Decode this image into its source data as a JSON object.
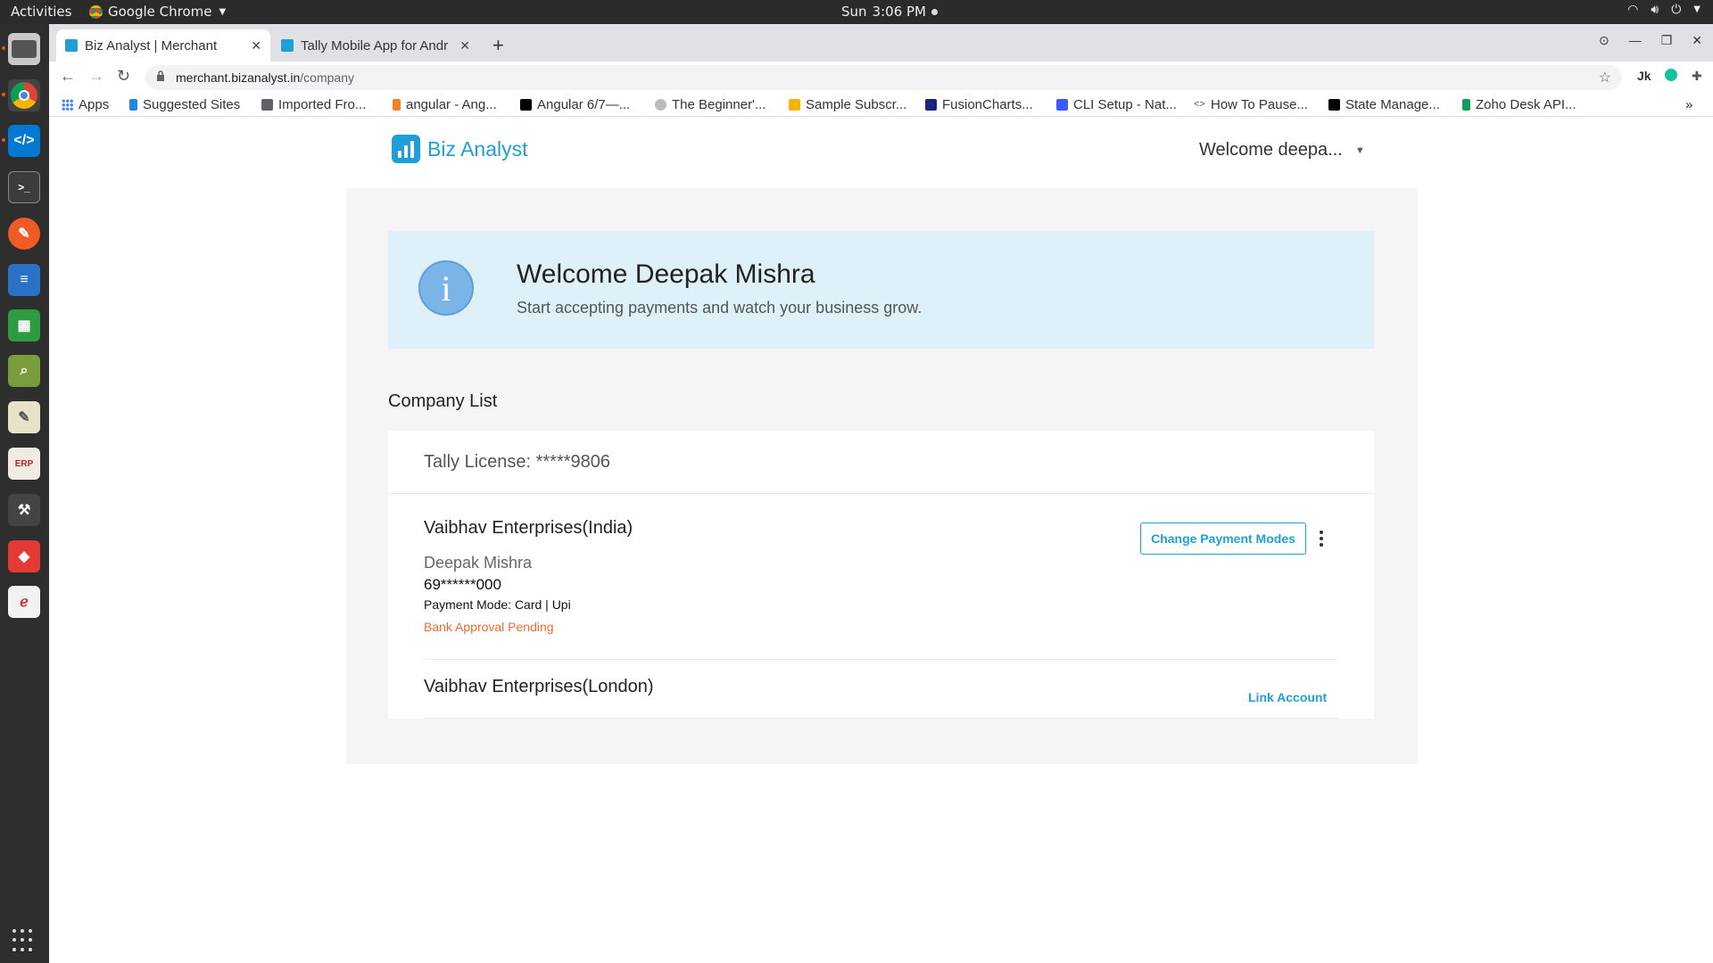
{
  "os": {
    "activities": "Activities",
    "app_name": "Google Chrome",
    "clock_day": "Sun",
    "clock_time": "3:06 PM"
  },
  "browser": {
    "tabs": [
      {
        "title": "Biz Analyst | Merchant",
        "active": true
      },
      {
        "title": "Tally Mobile App for Andr",
        "active": false
      }
    ],
    "url_host": "merchant.bizanalyst.in",
    "url_path": "/company",
    "bookmarks": [
      {
        "label": "Apps",
        "icon": "apps-grid-icon"
      },
      {
        "label": "Suggested Sites",
        "icon": "bing-icon"
      },
      {
        "label": "Imported Fro...",
        "icon": "folder-icon"
      },
      {
        "label": "angular - Ang...",
        "icon": "stackoverflow-icon"
      },
      {
        "label": "Angular 6/7—...",
        "icon": "medium-icon"
      },
      {
        "label": "The Beginner'...",
        "icon": "globe-icon"
      },
      {
        "label": "Sample Subscr...",
        "icon": "slides-icon"
      },
      {
        "label": "FusionCharts...",
        "icon": "fusioncharts-icon"
      },
      {
        "label": "CLI Setup - Nat...",
        "icon": "nativescript-icon"
      },
      {
        "label": "How To Pause...",
        "icon": "code-icon"
      },
      {
        "label": "State Manage...",
        "icon": "medium-icon"
      },
      {
        "label": "Zoho Desk API...",
        "icon": "zoho-icon"
      }
    ],
    "bookmarks_overflow": "»"
  },
  "app": {
    "brand": "Biz Analyst",
    "user_menu": "Welcome deepa...",
    "banner": {
      "title": "Welcome Deepak Mishra",
      "subtitle": "Start accepting payments and watch your business grow.",
      "icon": "i"
    },
    "company_heading": "Company List",
    "license": "Tally License: *****9806",
    "companies": [
      {
        "name": "Vaibhav Enterprises(India)",
        "owner": "Deepak Mishra",
        "phone": "69******000",
        "payment_mode": "Payment Mode: Card | Upi",
        "status": "Bank Approval Pending",
        "action": "Change Payment Modes"
      },
      {
        "name": "Vaibhav Enterprises(London)",
        "action": "Link Account"
      }
    ]
  },
  "colors": {
    "accent": "#1e9fd7",
    "banner_bg": "#def0f8",
    "panel_bg": "#f5f5f5",
    "pending": "#ef6c2f"
  }
}
